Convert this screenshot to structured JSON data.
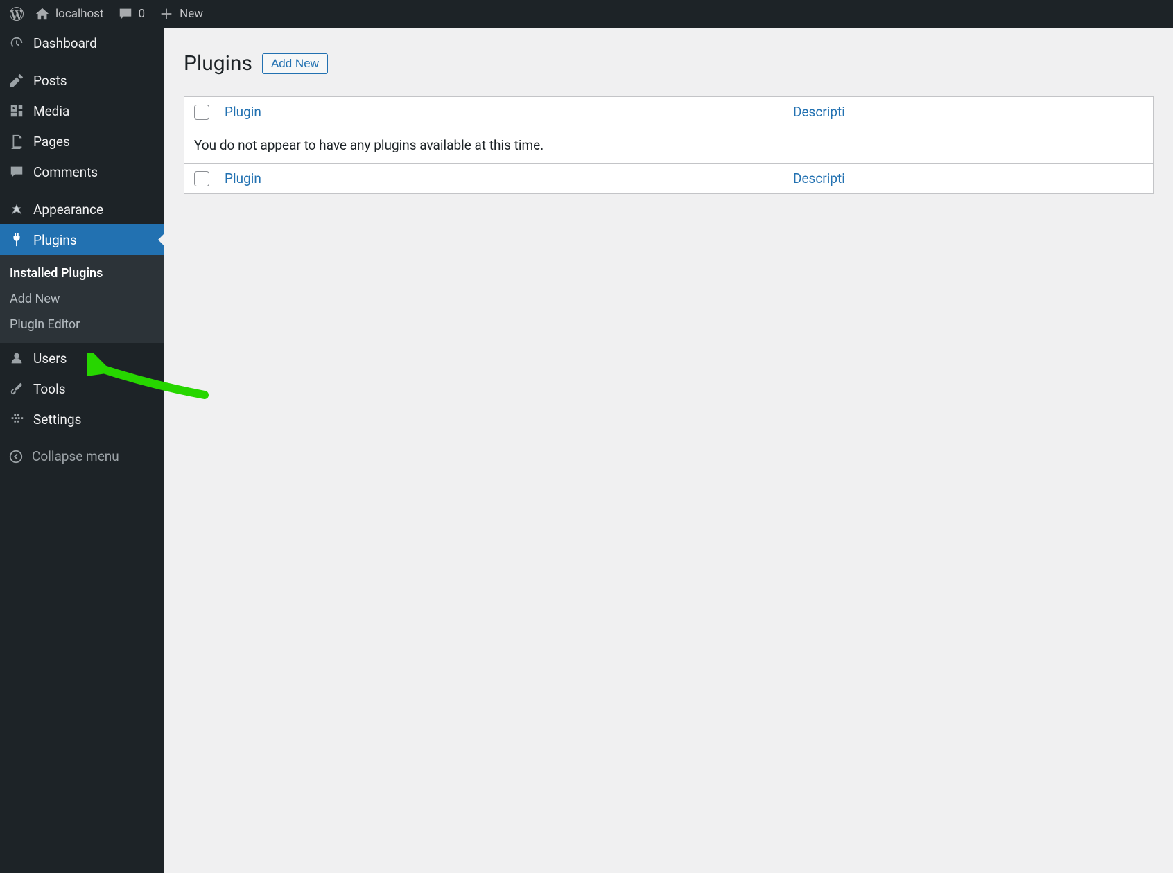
{
  "toolbar": {
    "site_name": "localhost",
    "comments_count": "0",
    "new_label": "New"
  },
  "sidebar": {
    "items": [
      {
        "label": "Dashboard",
        "icon": "dashboard"
      },
      {
        "label": "Posts",
        "icon": "posts"
      },
      {
        "label": "Media",
        "icon": "media"
      },
      {
        "label": "Pages",
        "icon": "pages"
      },
      {
        "label": "Comments",
        "icon": "comments"
      },
      {
        "label": "Appearance",
        "icon": "appearance"
      },
      {
        "label": "Plugins",
        "icon": "plugins"
      },
      {
        "label": "Users",
        "icon": "users"
      },
      {
        "label": "Tools",
        "icon": "tools"
      },
      {
        "label": "Settings",
        "icon": "settings"
      }
    ],
    "submenu": [
      {
        "label": "Installed Plugins",
        "current": true
      },
      {
        "label": "Add New",
        "current": false
      },
      {
        "label": "Plugin Editor",
        "current": false
      }
    ],
    "collapse_label": "Collapse menu"
  },
  "content": {
    "page_title": "Plugins",
    "page_action": "Add New",
    "table": {
      "col_plugin": "Plugin",
      "col_description": "Descripti",
      "empty_message": "You do not appear to have any plugins available at this time."
    }
  },
  "colors": {
    "accent": "#2271b1",
    "toolbar_bg": "#1d2327",
    "arrow": "#2ecc00"
  }
}
